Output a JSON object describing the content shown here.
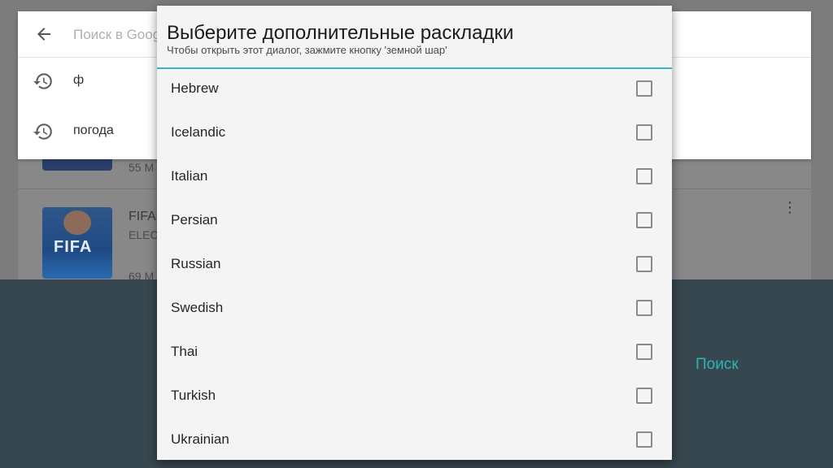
{
  "background": {
    "row1_size": "55 М",
    "row2_title": "FIFA",
    "row2_dev": "ELEC",
    "row2_size": "69 М",
    "thumb_text": "FIFA"
  },
  "search": {
    "placeholder": "Поиск в Goog",
    "suggestions": [
      {
        "text": "ф",
        "icon": "history-icon"
      },
      {
        "text": "погода",
        "icon": "history-icon"
      }
    ]
  },
  "keyboard": {
    "search_label": "Поиск",
    "accent_color": "#2fb3b8",
    "background_color": "#37474f"
  },
  "dialog": {
    "title": "Выберите дополнительные раскладки",
    "subtitle": "Чтобы открыть этот диалог, зажмите кнопку 'земной шар'",
    "divider_color": "#36b4c4",
    "languages": [
      {
        "label": "Hebrew",
        "checked": false
      },
      {
        "label": "Icelandic",
        "checked": false
      },
      {
        "label": "Italian",
        "checked": false
      },
      {
        "label": "Persian",
        "checked": false
      },
      {
        "label": "Russian",
        "checked": false
      },
      {
        "label": "Swedish",
        "checked": false
      },
      {
        "label": "Thai",
        "checked": false
      },
      {
        "label": "Turkish",
        "checked": false
      },
      {
        "label": "Ukrainian",
        "checked": false
      }
    ]
  }
}
